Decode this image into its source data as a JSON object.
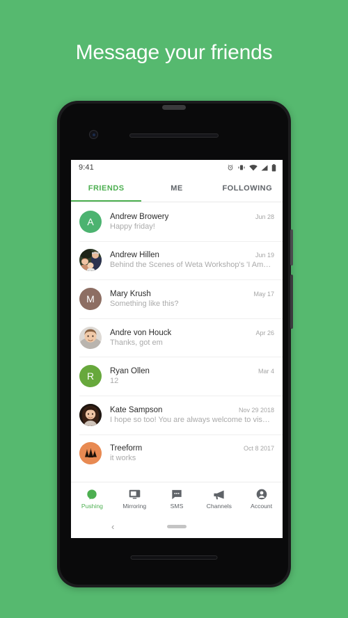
{
  "headline": "Message your friends",
  "theme": {
    "background_green": "#56b96f",
    "accent_green": "#4caf50"
  },
  "phone": {
    "statusbar": {
      "time": "9:41",
      "icons": [
        "alarm-icon",
        "vibrate-icon",
        "wifi-icon",
        "signal-icon",
        "battery-icon"
      ]
    },
    "tabs": [
      {
        "label": "FRIENDS",
        "active": true
      },
      {
        "label": "ME",
        "active": false
      },
      {
        "label": "FOLLOWING",
        "active": false
      }
    ],
    "conversations": [
      {
        "name": "Andrew Browery",
        "preview": "Happy friday!",
        "date": "Jun 28",
        "avatar_type": "initial",
        "initial": "A",
        "avatar_color": "#4cb370"
      },
      {
        "name": "Andrew Hillen",
        "preview": "Behind the Scenes of Weta Workshop's 'I Am…",
        "date": "Jun 19",
        "avatar_type": "photo-group",
        "initial": "",
        "avatar_color": "#5a6b4e"
      },
      {
        "name": "Mary Krush",
        "preview": "Something like this?",
        "date": "May 17",
        "avatar_type": "initial",
        "initial": "M",
        "avatar_color": "#8d6e63"
      },
      {
        "name": "Andre von Houck",
        "preview": "Thanks, got em",
        "date": "Apr 26",
        "avatar_type": "photo-man",
        "initial": "",
        "avatar_color": "#d9d5d0"
      },
      {
        "name": "Ryan Ollen",
        "preview": "12",
        "date": "Mar 4",
        "avatar_type": "initial",
        "initial": "R",
        "avatar_color": "#67a83c"
      },
      {
        "name": "Kate Sampson",
        "preview": "I hope so too! You are always welcome to vis…",
        "date": "Nov 29 2018",
        "avatar_type": "photo-woman",
        "initial": "",
        "avatar_color": "#2b2119"
      },
      {
        "name": "Treeform",
        "preview": "it works",
        "date": "Oct 8 2017",
        "avatar_type": "logo-trees",
        "initial": "",
        "avatar_color": "#e88a52"
      }
    ],
    "bottom_nav": [
      {
        "label": "Pushing",
        "icon": "push-bubble-icon",
        "active": true
      },
      {
        "label": "Mirroring",
        "icon": "monitor-icon",
        "active": false
      },
      {
        "label": "SMS",
        "icon": "chat-bubble-icon",
        "active": false
      },
      {
        "label": "Channels",
        "icon": "megaphone-icon",
        "active": false
      },
      {
        "label": "Account",
        "icon": "person-icon",
        "active": false
      }
    ],
    "android_nav": {
      "back": "‹",
      "home": "home-pill"
    }
  }
}
